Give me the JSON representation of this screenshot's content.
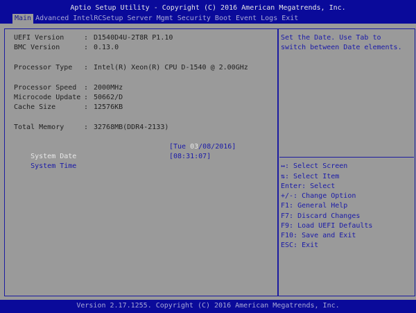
{
  "header": {
    "title": "Aptio Setup Utility - Copyright (C) 2016 American Megatrends, Inc.",
    "tabs": [
      "Main",
      "Advanced",
      "IntelRCSetup",
      "Server Mgmt",
      "Security",
      "Boot",
      "Event Logs",
      "Exit"
    ],
    "active_tab": "Main"
  },
  "info": [
    {
      "label": "UEFI Version",
      "value": "D1540D4U-2T8R P1.10"
    },
    {
      "label": "BMC Version",
      "value": "0.13.0"
    },
    {
      "label": "Processor Type",
      "value": "Intel(R) Xeon(R) CPU D-1540 @ 2.00GHz"
    },
    {
      "label": "Processor Speed",
      "value": "2000MHz"
    },
    {
      "label": "Microcode Update",
      "value": "50662/D"
    },
    {
      "label": "Cache Size",
      "value": "12576KB"
    },
    {
      "label": "Total Memory",
      "value": "32768MB(DDR4-2133)"
    }
  ],
  "separator": ":",
  "system_date": {
    "label": "System Date",
    "prefix": "[Tue ",
    "highlight": "03",
    "suffix": "/08/2016]"
  },
  "system_time": {
    "label": "System Time",
    "value": "[08:31:07]"
  },
  "help": [
    "Set the Date. Use Tab to",
    "switch between Date elements."
  ],
  "keys": [
    "↔: Select Screen",
    "⇅: Select Item",
    "Enter: Select",
    "+/-: Change Option",
    "F1: General Help",
    "F7: Discard Changes",
    "F9: Load UEFI Defaults",
    "F10: Save and Exit",
    "ESC: Exit"
  ],
  "footer": "Version 2.17.1255. Copyright (C) 2016 American Megatrends, Inc."
}
